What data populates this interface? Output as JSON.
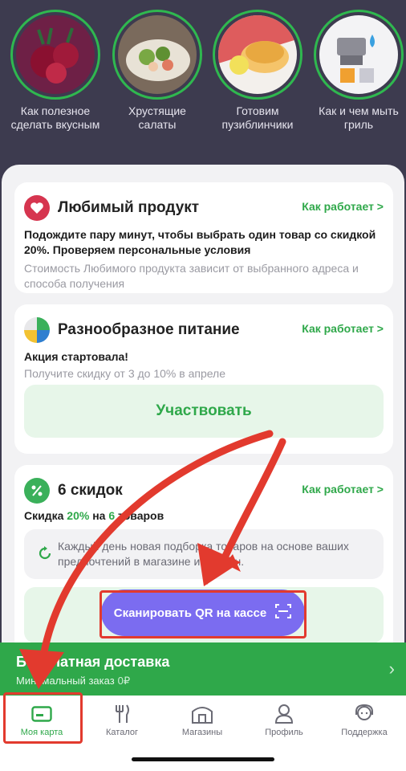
{
  "stories": [
    {
      "label": "Как полезное сделать вкусным",
      "icon": "beet-icon"
    },
    {
      "label": "Хрустящие салаты",
      "icon": "salad-icon"
    },
    {
      "label": "Готовим пузиблинчики",
      "icon": "pancakes-icon"
    },
    {
      "label": "Как и чем мыть гриль",
      "icon": "grill-icon"
    }
  ],
  "favorite": {
    "title": "Любимый продукт",
    "link": "Как работает >",
    "bold": "Подождите пару минут, чтобы выбрать один товар со скидкой 20%. Проверяем персональные условия",
    "note": "Стоимость Любимого продукта зависит от выбранного адреса и способа получения",
    "icon": "heart-icon"
  },
  "diverse": {
    "title": "Разнообразное питание",
    "link": "Как работает >",
    "bold": "Акция стартовала!",
    "note": "Получите скидку от 3 до 10% в апреле",
    "button": "Участвовать",
    "icon": "food-mix-icon"
  },
  "six": {
    "title": "6 скидок",
    "link": "Как работает >",
    "discount_prefix": "Скидка",
    "discount_value": "20%",
    "discount_mid": "на",
    "discount_count": "6",
    "discount_suffix": "товаров",
    "info": "Каждый день новая подборка товаров на основе ваших предпочтений в магазине и онлайн.",
    "icon": "percent-icon"
  },
  "scan_button": "Сканировать QR на кассе",
  "delivery": {
    "title": "Бесплатная доставка",
    "subtitle": "Минимальный заказ",
    "value": "0₽"
  },
  "tabs": [
    {
      "label": "Моя карта",
      "icon": "card-icon"
    },
    {
      "label": "Каталог",
      "icon": "cutlery-icon"
    },
    {
      "label": "Магазины",
      "icon": "store-icon"
    },
    {
      "label": "Профиль",
      "icon": "profile-icon"
    },
    {
      "label": "Поддержка",
      "icon": "support-icon"
    }
  ],
  "colors": {
    "accent_green": "#2fa84a",
    "scan_purple": "#7b6cf0",
    "annotation_red": "#e23a2e",
    "header_bg": "#3d3b4f"
  }
}
